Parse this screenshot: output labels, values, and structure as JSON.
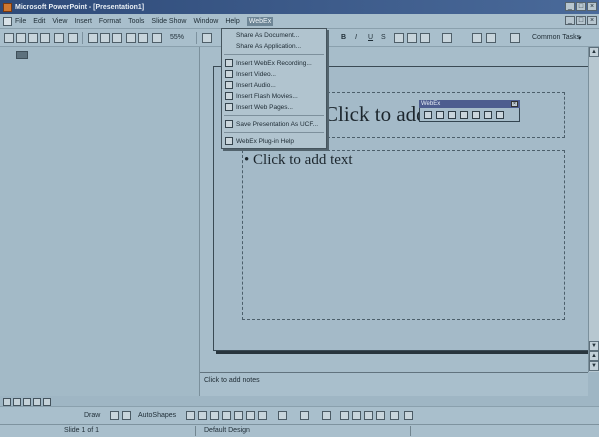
{
  "window": {
    "title": "Microsoft PowerPoint - [Presentation1]",
    "controls": [
      "_",
      "□",
      "×"
    ]
  },
  "menubar": {
    "items": [
      "File",
      "Edit",
      "View",
      "Insert",
      "Format",
      "Tools",
      "Slide Show",
      "Window",
      "Help",
      "WebEx"
    ],
    "active": "WebEx"
  },
  "toolbar": {
    "zoom": "55%",
    "font_buttons": [
      "B",
      "I",
      "U",
      "S"
    ],
    "common_tasks": "Common Tasks"
  },
  "webex_menu": {
    "items": [
      {
        "label": "Share As Document...",
        "icon": ""
      },
      {
        "label": "Share As Application...",
        "icon": ""
      },
      {
        "label": "Insert WebEx Recording...",
        "icon": "webex-recording-icon"
      },
      {
        "label": "Insert Video...",
        "icon": "video-icon"
      },
      {
        "label": "Insert Audio...",
        "icon": "audio-icon"
      },
      {
        "label": "Insert Flash Movies...",
        "icon": "flash-movie-icon"
      },
      {
        "label": "Insert Web Pages...",
        "icon": "web-page-icon"
      },
      {
        "label": "Save Presentation As UCF...",
        "icon": "save-ucf-icon"
      },
      {
        "label": "WebEx Plug-in Help",
        "icon": "help-icon"
      }
    ]
  },
  "floating_toolbar": {
    "title": "WebEx",
    "close": "×"
  },
  "slide": {
    "title_placeholder": "Click to add title",
    "body_placeholder": "Click to add text",
    "bullet": "•"
  },
  "notes": {
    "placeholder": "Click to add notes"
  },
  "drawing_toolbar": {
    "draw": "Draw",
    "autoshapes": "AutoShapes"
  },
  "statusbar": {
    "slide_count": "Slide 1 of 1",
    "design": "Default Design"
  }
}
